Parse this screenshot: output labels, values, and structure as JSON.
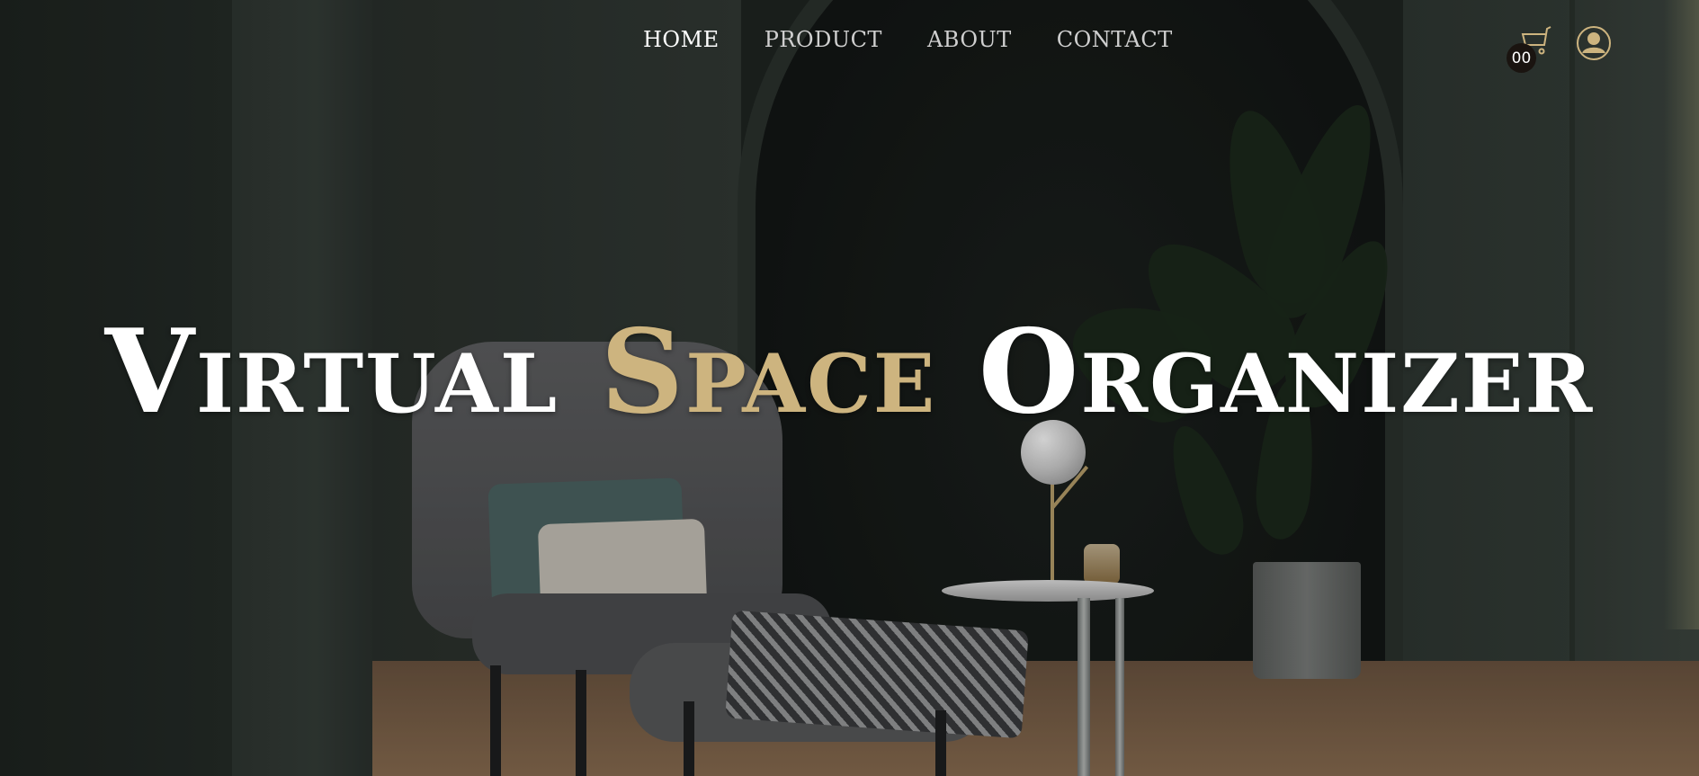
{
  "nav": {
    "items": [
      {
        "label": "HOME",
        "active": true
      },
      {
        "label": "PRODUCT",
        "active": false
      },
      {
        "label": "ABOUT",
        "active": false
      },
      {
        "label": "CONTACT",
        "active": false
      }
    ]
  },
  "header": {
    "cart_count": "00",
    "cart_icon": "cart-icon",
    "user_icon": "user-account-icon"
  },
  "hero": {
    "title_word1": "Virtual",
    "title_word2": "Space",
    "title_word3": "Organizer"
  },
  "colors": {
    "accent": "#cdb47f",
    "text": "#ffffff",
    "nav_text": "#cfcfcf",
    "background": "#1f2522"
  }
}
